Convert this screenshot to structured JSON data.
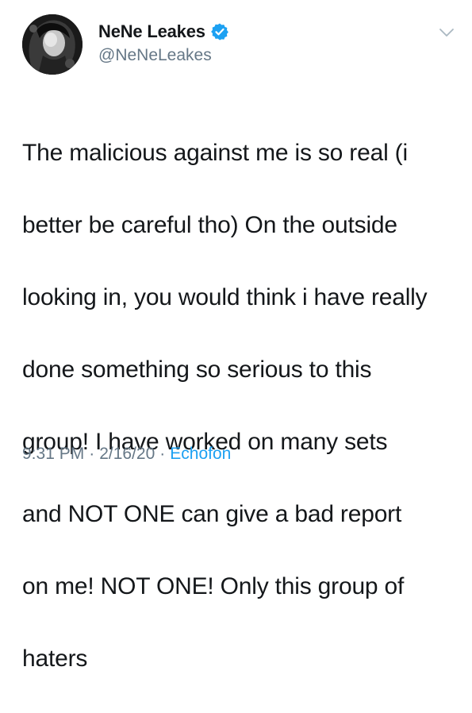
{
  "user": {
    "display_name": "NeNe Leakes",
    "handle": "@NeNeLeakes",
    "verified": true,
    "avatar_icon": "profile-photo"
  },
  "tweet": {
    "lines": [
      "The malicious against me is so real (i",
      "better be careful tho) On the outside",
      "looking in, you would think i have really",
      "done something so serious to this",
      "group! I have worked on many sets",
      "and NOT ONE can give a bad report",
      "on me! NOT ONE! Only this group of",
      "haters"
    ]
  },
  "meta": {
    "time": "9:31 PM",
    "date": "2/16/20",
    "separator": "·",
    "source": "Echofon"
  },
  "colors": {
    "text": "#14171a",
    "secondary": "#657786",
    "accent": "#1da1f2",
    "chevron": "#aab8c2"
  },
  "icons": {
    "verified": "verified-badge-icon",
    "more": "chevron-down-icon"
  }
}
